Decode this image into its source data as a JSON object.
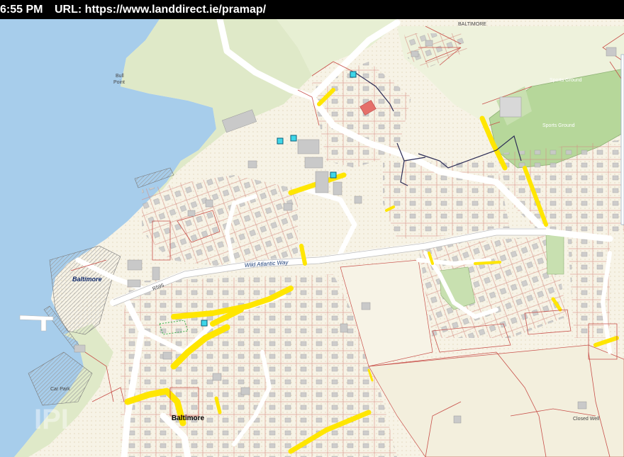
{
  "status_bar": {
    "time": "6:55 PM",
    "url_label": "URL:",
    "url": "https://www.landdirect.ie/pramap/"
  },
  "map": {
    "labels": {
      "baltimore_top": "BALTIMORE",
      "baltimore_town": "Baltimore",
      "baltimore_harbour": "Baltimore",
      "bull": "Bull",
      "point": "Point",
      "sports_ground_1": "Sports Ground",
      "sports_ground_2": "Sports Ground",
      "wild_atlantic_way": "Wild Atlantic Way",
      "r595": "R595",
      "car_park": "Car Park",
      "closed_well": "Closed Well",
      "watermark": "IPI"
    },
    "colors": {
      "sea": "#a7cdeb",
      "land": "#f7f3e6",
      "green": "#dfe9c8",
      "sports": "#b6d79a",
      "road": "#ffffff",
      "parcel_line": "#c8504a",
      "yellow": "#ffe600",
      "boundary": "#2b2b55",
      "marker": "#3ed6e8"
    }
  }
}
